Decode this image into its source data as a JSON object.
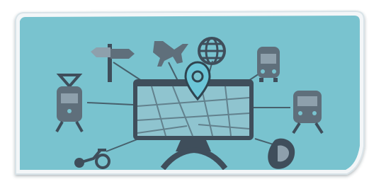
{
  "image": {
    "description_free": true
  },
  "colors": {
    "background": "#ffffff",
    "panel": "#79c3cf",
    "panel_dark": "#5aa7b4",
    "icon_dark": "#3f4e5b",
    "icon_mid": "#5f6f7b",
    "icon_light": "#8ea0ac",
    "line": "#47606c",
    "map_bg": "#8fc4cf",
    "pin": "#6cc6d8"
  },
  "icons": [
    "signpost-icon",
    "airplane-icon",
    "globe-icon",
    "bus-icon",
    "tram-icon",
    "train-icon",
    "scooter-icon",
    "phone-icon",
    "map-pin-icon"
  ]
}
